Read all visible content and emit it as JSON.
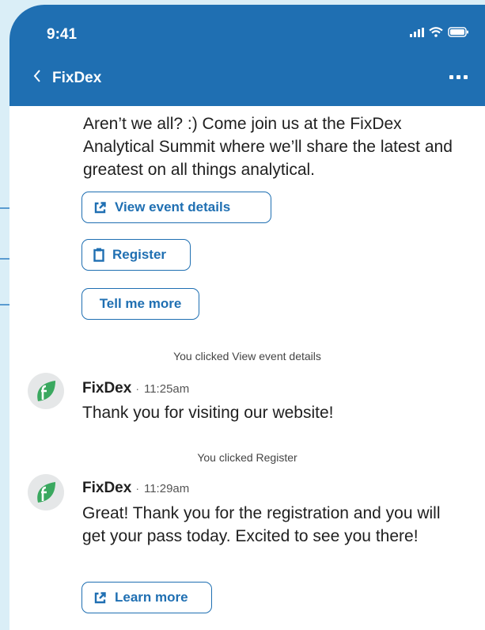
{
  "status_bar": {
    "time": "9:41"
  },
  "nav": {
    "title": "FixDex"
  },
  "intro_message": "Aren’t we all? :) Come join us at the FixDex Analytical Summit where we’ll share the latest and greatest on all things analytical.",
  "buttons": {
    "view_event": "View event details",
    "register": "Register",
    "tell_more": "Tell me more",
    "learn_more": "Learn more"
  },
  "events": [
    {
      "text": "You clicked View event details"
    },
    {
      "text": "You clicked Register"
    }
  ],
  "messages": [
    {
      "sender": "FixDex",
      "separator": "·",
      "time": "11:25am",
      "text": "Thank you for visiting our website!"
    },
    {
      "sender": "FixDex",
      "separator": "·",
      "time": "11:29am",
      "text": "Great! Thank you for the registration and you will get your pass today. Excited to see you there!"
    }
  ],
  "colors": {
    "brand": "#1f6fb2",
    "background": "#daeef7",
    "avatar_leaf": "#3aa85f"
  },
  "icons": [
    "signal-icon",
    "wifi-icon",
    "battery-icon",
    "back-chevron-icon",
    "more-icon",
    "external-link-icon",
    "clipboard-icon"
  ]
}
